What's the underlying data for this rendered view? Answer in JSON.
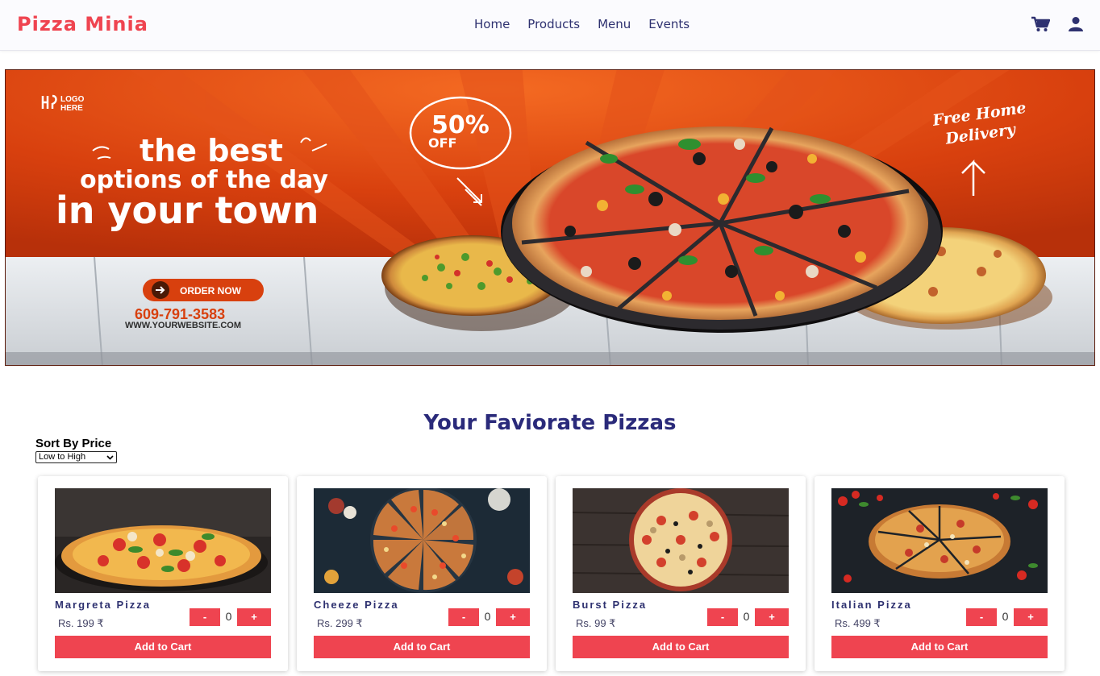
{
  "navbar": {
    "brand": "Pizza Minia",
    "links": [
      "Home",
      "Products",
      "Menu",
      "Events"
    ],
    "icons": [
      "cart-icon",
      "user-icon"
    ],
    "brand_color": "#ef4450",
    "link_color": "#2e3170"
  },
  "hero": {
    "logo_text_1": "LOGO",
    "logo_text_2": "HERE",
    "headline_1": "the best",
    "headline_2": "options of the day",
    "headline_3": "in your town",
    "offer_percent": "50%",
    "offer_word": "OFF",
    "delivery_1": "Free Home",
    "delivery_2": "Delivery",
    "order_button": "ORDER NOW",
    "phone": "609-791-3583",
    "website": "WWW.YOURWEBSITE.COM"
  },
  "section": {
    "title": "Your Faviorate Pizzas",
    "sort_label": "Sort By Price",
    "sort_selected": "Low to High"
  },
  "products": [
    {
      "name": "Margreta Pizza",
      "price": "Rs. 199 ₹",
      "qty": "0",
      "minus": "-",
      "plus": "+",
      "add": "Add to Cart"
    },
    {
      "name": "Cheeze Pizza",
      "price": "Rs. 299 ₹",
      "qty": "0",
      "minus": "-",
      "plus": "+",
      "add": "Add to Cart"
    },
    {
      "name": "Burst Pizza",
      "price": "Rs. 99 ₹",
      "qty": "0",
      "minus": "-",
      "plus": "+",
      "add": "Add to Cart"
    },
    {
      "name": "Italian Pizza",
      "price": "Rs. 499 ₹",
      "qty": "0",
      "minus": "-",
      "plus": "+",
      "add": "Add to Cart"
    }
  ],
  "colors": {
    "accent": "#ef4450",
    "title": "#2a2a7a",
    "hero_orange": "#d8400e"
  }
}
